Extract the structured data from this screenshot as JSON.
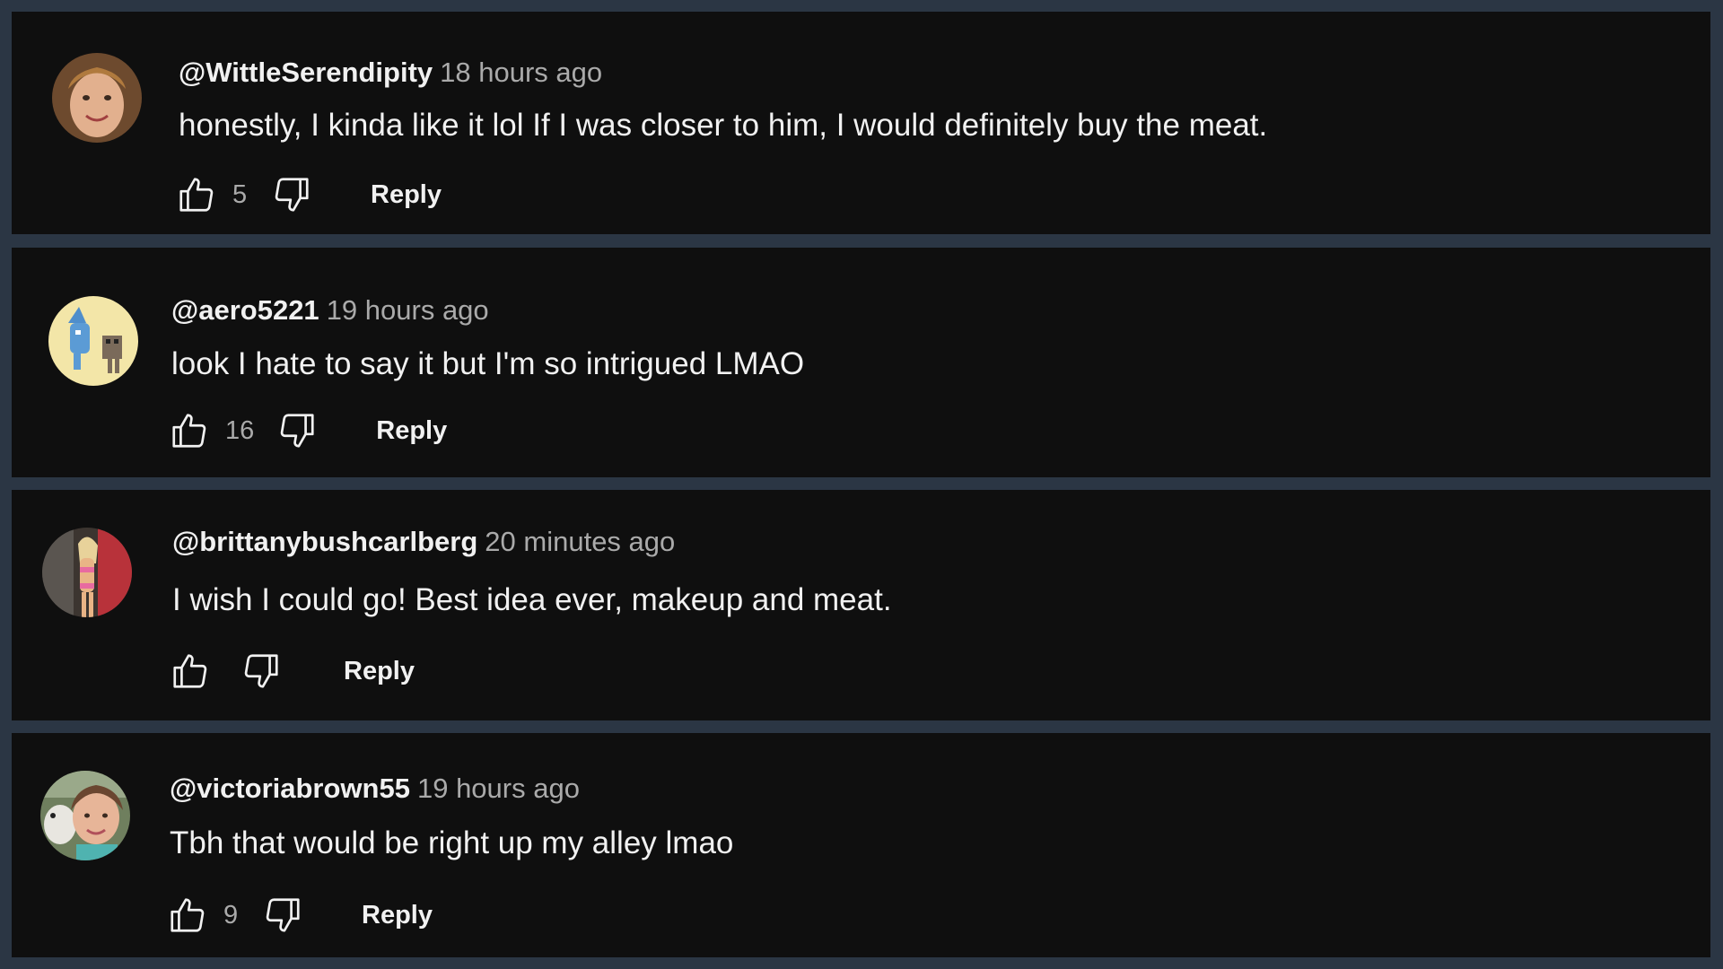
{
  "comments": [
    {
      "handle": "@WittleSerendipity",
      "time": "18 hours ago",
      "text": "honestly, I kinda like it lol If I was closer to him, I would definitely buy the meat.",
      "likes": "5",
      "reply_label": "Reply",
      "avatar_icon": "avatar-woman-portrait"
    },
    {
      "handle": "@aero5221",
      "time": "19 hours ago",
      "text": "look I hate to say it but I'm so intrigued LMAO",
      "likes": "16",
      "reply_label": "Reply",
      "avatar_icon": "avatar-cartoon-bird"
    },
    {
      "handle": "@brittanybushcarlberg",
      "time": "20 minutes ago",
      "text": "I wish I could go! Best idea ever, makeup and meat.",
      "likes": "",
      "reply_label": "Reply",
      "avatar_icon": "avatar-fitness-photo"
    },
    {
      "handle": "@victoriabrown55",
      "time": "19 hours ago",
      "text": "Tbh that would be right up my alley lmao",
      "likes": "9",
      "reply_label": "Reply",
      "avatar_icon": "avatar-woman-with-dog"
    }
  ],
  "colors": {
    "page_background": "#2b3644",
    "card_background": "#0f0f0f",
    "primary_text": "#f1f1f1",
    "secondary_text": "#aaaaaa"
  }
}
